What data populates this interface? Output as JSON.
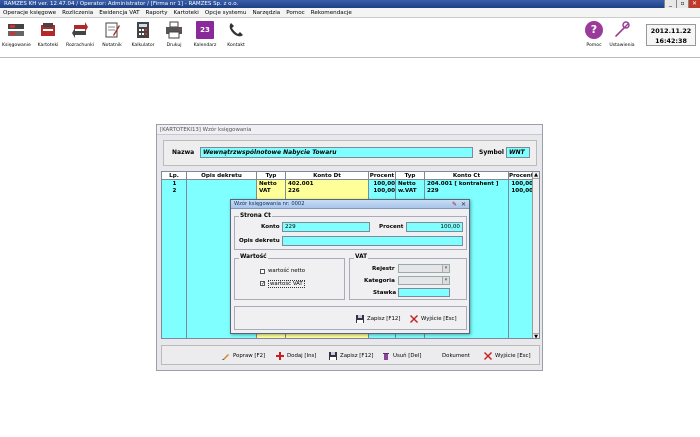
{
  "app": {
    "title": "RAMZES KH ver. 12.47.04 /   Operator: Administrator /   [Firma nr 1] - RAMZES Sp. z o.o."
  },
  "menu": [
    "Operacje księgowe",
    "Rozliczenia",
    "Ewidencja VAT",
    "Raporty",
    "Kartoteki",
    "Opcje systemu",
    "Narzędzia",
    "Pomoc",
    "Rekomendacje"
  ],
  "toolbar": {
    "buttons": [
      {
        "label": "Księgowanie",
        "icon": "booking-icon"
      },
      {
        "label": "Kartoteki",
        "icon": "cards-icon"
      },
      {
        "label": "Rozrachunki",
        "icon": "settlements-icon"
      },
      {
        "label": "Notatnik",
        "icon": "notepad-icon"
      },
      {
        "label": "Kalkulator",
        "icon": "calculator-icon"
      },
      {
        "label": "Drukuj",
        "icon": "printer-icon"
      },
      {
        "label": "Kalendarz",
        "icon": "calendar-icon"
      },
      {
        "label": "Kontakt",
        "icon": "phone-icon"
      }
    ],
    "help_label": "Pomoc",
    "settings_label": "Ustawienia",
    "calendar_day": "23",
    "clock_date": "2012.11.22",
    "clock_time": "16:42:38"
  },
  "window": {
    "title": "[KARTOTEKI13]  Wzór księgowania",
    "name_label": "Nazwa",
    "name_value": "Wewnątrzwspólnotowe Nabycie Towaru",
    "symbol_label": "Symbol",
    "symbol_value": "WNT",
    "columns": [
      "Lp.",
      "Opis dekretu",
      "Typ",
      "Konto Dt",
      "Procent",
      "Typ",
      "Konto Ct",
      "Procent"
    ],
    "rows": [
      [
        "1",
        "",
        "Netto",
        "402.001",
        "100,00",
        "Netto",
        "204.001 [ kontrahent ]",
        "100,00"
      ],
      [
        "2",
        "",
        "VAT",
        "226",
        "100,00",
        "w.VAT",
        "229",
        "100,00"
      ]
    ],
    "buttons": {
      "edit": "Popraw  [F2]",
      "add": "Dodaj  [Ins]",
      "save": "Zapisz  [F12]",
      "delete": "Usuń  [Del]",
      "document": "Dokument",
      "exit": "Wyjście  [Esc]"
    }
  },
  "dialog": {
    "title": "Wzór księgowania nr: 0002",
    "section_side": "Strona Ct",
    "account_label": "Konto",
    "account_value": "229",
    "percent_label": "Procent",
    "percent_value": "100,00",
    "desc_label": "Opis dekretu",
    "desc_value": "",
    "value_section": "Wartość",
    "chk_net_label": "wartość netto",
    "chk_net_checked": false,
    "chk_vat_label": "wartość VAT",
    "chk_vat_checked": true,
    "check_mark": "✓",
    "vat_section": "VAT",
    "register_label": "Rejestr",
    "category_label": "Kategoria",
    "rate_label": "Stawka",
    "save_label": "Zapisz  [F12]",
    "exit_label": "Wyjście  [Esc]"
  },
  "colors": {
    "field": "#7fffff",
    "highlight": "#ffff99",
    "titlebar": "#1d3f86",
    "grid_border": "#7c8a9a",
    "exit_red": "#c81e1e"
  }
}
